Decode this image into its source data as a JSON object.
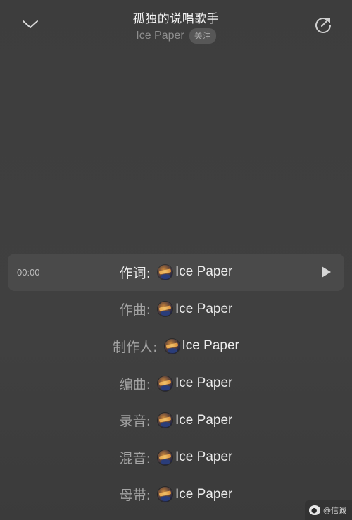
{
  "header": {
    "back_icon": "chevron-down-icon",
    "title": "孤独的说唱歌手",
    "artist": "Ice Paper",
    "follow_label": "关注",
    "share_icon": "share-rotate-icon"
  },
  "credits": {
    "current_time": "00:00",
    "play_icon": "play-icon",
    "rows": [
      {
        "role": "作词:",
        "name": "Ice Paper"
      },
      {
        "role": "作曲:",
        "name": "Ice Paper"
      },
      {
        "role": "制作人:",
        "name": "Ice Paper"
      },
      {
        "role": "编曲:",
        "name": "Ice Paper"
      },
      {
        "role": "录音:",
        "name": "Ice Paper"
      },
      {
        "role": "混音:",
        "name": "Ice Paper"
      },
      {
        "role": "母带:",
        "name": "Ice Paper"
      }
    ]
  },
  "watermark": {
    "text": "@信诚",
    "icon": "weibo-logo-icon"
  },
  "colors": {
    "background": "#3f3f3f",
    "active_row": "#4a4a4a",
    "text_primary": "#ececec",
    "text_secondary": "#a3a3a3",
    "artist_text": "#8e8e8e",
    "follow_bg": "#575757"
  }
}
